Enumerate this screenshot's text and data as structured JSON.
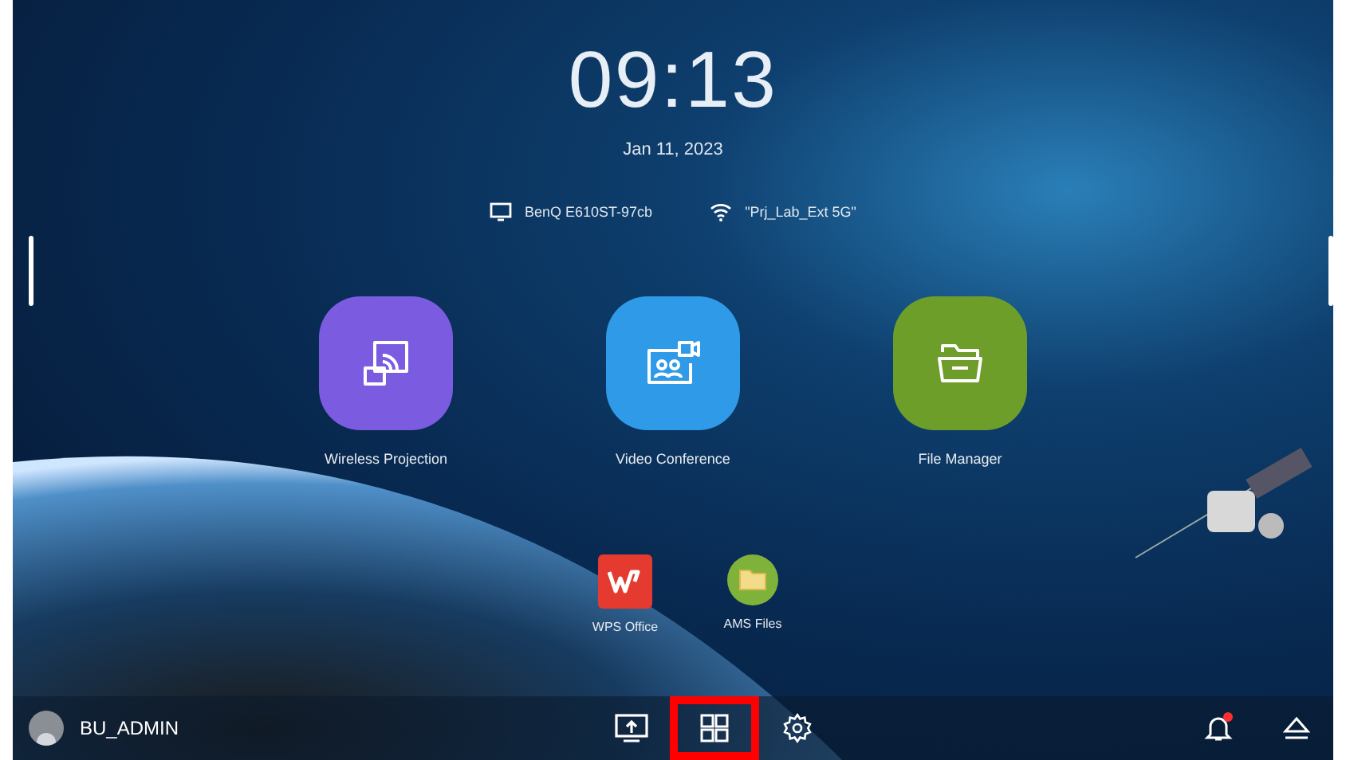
{
  "clock": {
    "time": "09:13",
    "date": "Jan 11, 2023"
  },
  "status": {
    "device": "BenQ E610ST-97cb",
    "network": "\"Prj_Lab_Ext 5G\""
  },
  "apps": [
    {
      "label": "Wireless Projection",
      "kind": "projection",
      "color": "#7b5ce0"
    },
    {
      "label": "Video Conference",
      "kind": "conference",
      "color": "#2f9be8"
    },
    {
      "label": "File Manager",
      "kind": "files",
      "color": "#6e9e2a"
    }
  ],
  "shortcuts": [
    {
      "label": "WPS Office",
      "kind": "wps"
    },
    {
      "label": "AMS Files",
      "kind": "ams"
    }
  ],
  "taskbar": {
    "user": "BU_ADMIN",
    "buttons": [
      {
        "kind": "screen",
        "highlighted": false
      },
      {
        "kind": "apps",
        "highlighted": true
      },
      {
        "kind": "settings",
        "highlighted": false
      }
    ],
    "notification_unread": true
  }
}
